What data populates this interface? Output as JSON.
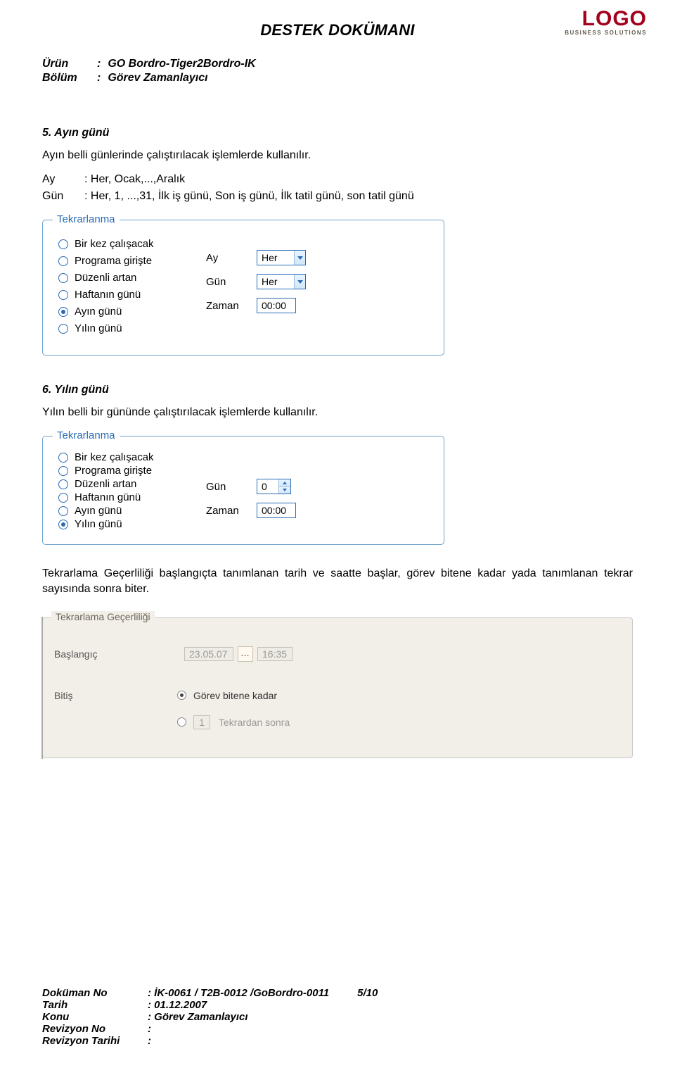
{
  "header": {
    "title": "DESTEK DOKÜMANI",
    "logo_main": "LOGO",
    "logo_sub": "BUSINESS SOLUTIONS"
  },
  "meta": {
    "product_label": "Ürün",
    "product_value": "GO Bordro-Tiger2Bordro-IK",
    "section_label": "Bölüm",
    "section_value": "Görev Zamanlayıcı",
    "separator": ":"
  },
  "section5": {
    "heading": "5. Ayın günü",
    "desc": "Ayın belli günlerinde çalıştırılacak işlemlerde kullanılır.",
    "kv": [
      {
        "key": "Ay",
        "val": ": Her, Ocak,...,Aralık"
      },
      {
        "key": "Gün",
        "val": ": Her, 1, ...,31, İlk iş günü, Son iş günü, İlk tatil günü, son tatil günü"
      }
    ]
  },
  "panelA": {
    "legend": "Tekrarlanma",
    "radios": [
      "Bir kez çalışacak",
      "Programa girişte",
      "Düzenli artan",
      "Haftanın günü",
      "Ayın günü",
      "Yılın günü"
    ],
    "selected_index": 4,
    "fields": {
      "ay": {
        "label": "Ay",
        "value": "Her"
      },
      "gun": {
        "label": "Gün",
        "value": "Her"
      },
      "zaman": {
        "label": "Zaman",
        "value": "00:00"
      }
    }
  },
  "section6": {
    "heading": "6. Yılın günü",
    "desc": "Yılın belli bir gününde çalıştırılacak işlemlerde kullanılır."
  },
  "panelB": {
    "legend": "Tekrarlanma",
    "radios": [
      "Bir kez çalışacak",
      "Programa girişte",
      "Düzenli artan",
      "Haftanın günü",
      "Ayın günü",
      "Yılın günü"
    ],
    "selected_index": 5,
    "fields": {
      "gun": {
        "label": "Gün",
        "value": "0"
      },
      "zaman": {
        "label": "Zaman",
        "value": "00:00"
      }
    }
  },
  "paragraph": "Tekrarlama Geçerliliği başlangıçta tanımlanan tarih ve saatte başlar, görev bitene kadar yada tanımlanan tekrar sayısında sonra biter.",
  "screenshot": {
    "legend": "Tekrarlama Geçerliliği",
    "start_label": "Başlangıç",
    "start_date": "23.05.07",
    "picker_label": "...",
    "start_time": "16:35",
    "end_label": "Bitiş",
    "end_option": "Görev bitene kadar",
    "count_value": "1",
    "count_suffix": "Tekrardan sonra"
  },
  "footer": {
    "doc_no_label": "Doküman No",
    "doc_no_value": ": İK-0061 / T2B-0012 /GoBordro-0011",
    "page": "5/10",
    "date_label": "Tarih",
    "date_value": ": 01.12.2007",
    "subject_label": "Konu",
    "subject_value": ": Görev Zamanlayıcı",
    "rev_no_label": "Revizyon No",
    "rev_no_value": ":",
    "rev_date_label": "Revizyon Tarihi",
    "rev_date_value": ":"
  }
}
